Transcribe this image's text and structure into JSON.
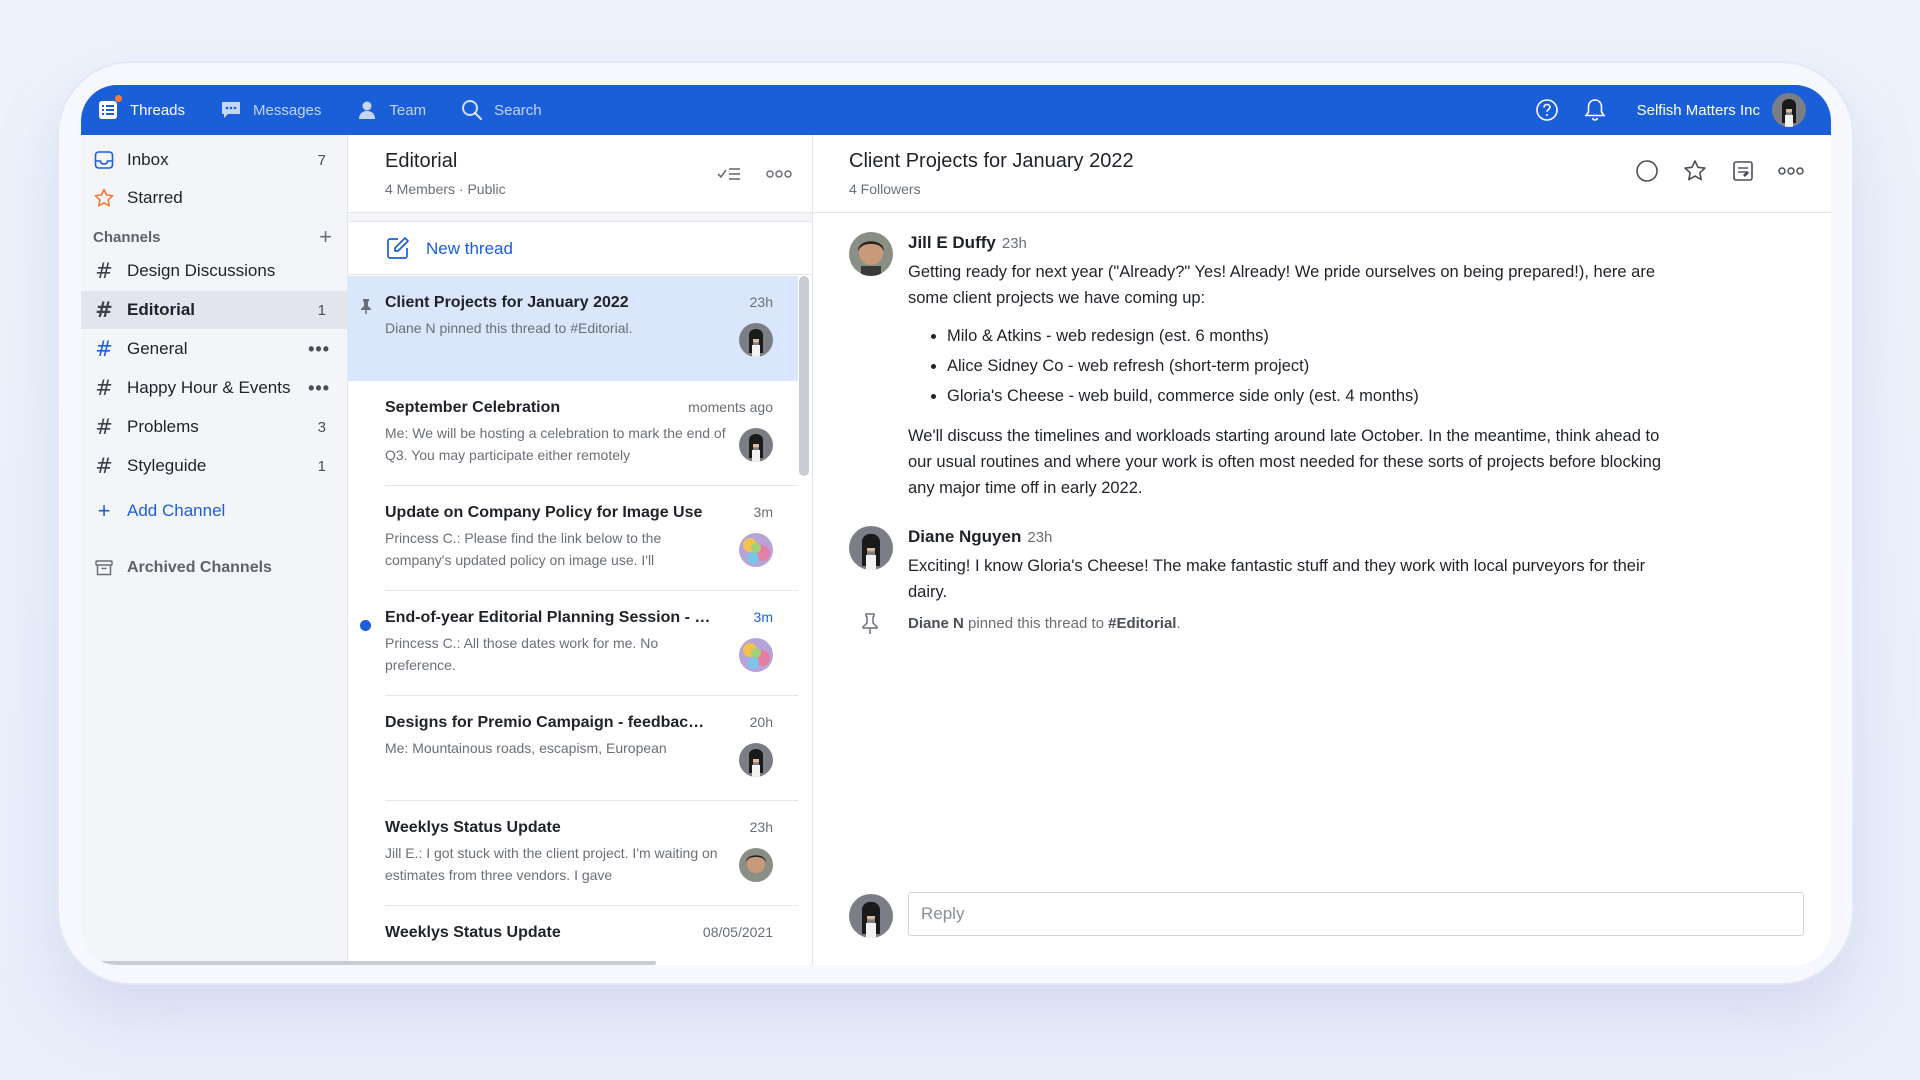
{
  "nav": {
    "threads": "Threads",
    "messages": "Messages",
    "team": "Team",
    "search": "Search",
    "org_name": "Selfish Matters Inc"
  },
  "sidebar": {
    "inbox": {
      "label": "Inbox",
      "count": "7"
    },
    "starred": {
      "label": "Starred"
    },
    "channels_heading": "Channels",
    "channels": [
      {
        "label": "Design Discussions",
        "count": ""
      },
      {
        "label": "Editorial",
        "count": "1"
      },
      {
        "label": "General",
        "count": ""
      },
      {
        "label": "Happy Hour & Events",
        "count": ""
      },
      {
        "label": "Problems",
        "count": "3"
      },
      {
        "label": "Styleguide",
        "count": "1"
      }
    ],
    "add_channel": "Add Channel",
    "archived": "Archived Channels"
  },
  "channel": {
    "title": "Editorial",
    "subtitle": "4 Members · Public",
    "new_thread": "New thread"
  },
  "threads": [
    {
      "title": "Client Projects for January 2022",
      "time": "23h",
      "preview": "Diane N pinned this thread to #Editorial."
    },
    {
      "title": "September Celebration",
      "time": "moments ago",
      "preview": "Me: We will be hosting a celebration to mark the end of Q3. You may participate either remotely"
    },
    {
      "title": "Update on Company Policy for Image Use",
      "time": "3m",
      "preview": "Princess C.: Please find the link below to the company's updated policy on image use. I'll"
    },
    {
      "title": "End-of-year Editorial Planning Session - …",
      "time": "3m",
      "preview": "Princess C.: All those dates work for me. No preference."
    },
    {
      "title": "Designs for Premio Campaign - feedbac…",
      "time": "20h",
      "preview": "Me: Mountainous roads, escapism, European"
    },
    {
      "title": "Weeklys Status Update",
      "time": "23h",
      "preview": "Jill E.: I got stuck with the client project. I'm waiting on estimates from three vendors. I gave"
    },
    {
      "title": "Weeklys Status Update",
      "time": "08/05/2021",
      "preview": ""
    }
  ],
  "detail": {
    "title": "Client Projects for January 2022",
    "followers": "4 Followers",
    "messages": [
      {
        "author": "Jill E Duffy",
        "time": "23h",
        "intro": "Getting ready for next year (\"Already?\" Yes! Already! We pride ourselves on being prepared!), here are some client projects we have coming up:",
        "bullets": [
          "Milo & Atkins - web redesign (est. 6 months)",
          "Alice Sidney Co - web refresh (short-term project)",
          "Gloria's Cheese - web build, commerce side only (est. 4 months)"
        ],
        "outro": "We'll discuss the timelines and workloads starting around late October. In the meantime, think ahead to our usual routines and where your work is often most needed for these sorts of projects before blocking any major time off in early 2022."
      },
      {
        "author": "Diane Nguyen",
        "time": "23h",
        "intro": "Exciting! I know Gloria's Cheese! The make fantastic stuff and they work with local purveyors for their dairy."
      }
    ],
    "pin_note": {
      "who": "Diane N",
      "middle": " pinned this thread to ",
      "channel": "#Editorial",
      "end": "."
    },
    "reply_placeholder": "Reply"
  },
  "colors": {
    "accent": "#1b5fd8",
    "selected_row": "#d9e6fb",
    "sidebar_bg": "#f4f5f8",
    "star": "#f07a36"
  }
}
